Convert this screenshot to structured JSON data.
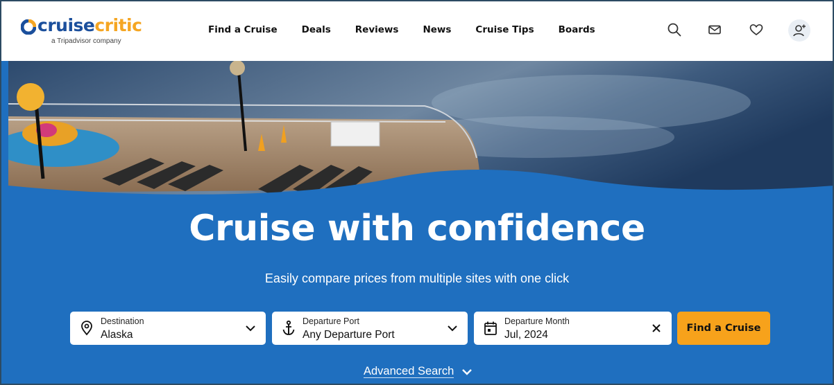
{
  "brand": {
    "name_part1": "cruise",
    "name_part2": "critic",
    "tagline": "a Tripadvisor company"
  },
  "nav": [
    "Find a Cruise",
    "Deals",
    "Reviews",
    "News",
    "Cruise Tips",
    "Boards"
  ],
  "header_icons": [
    "search-icon",
    "mail-icon",
    "heart-icon",
    "user-add-icon"
  ],
  "hero": {
    "headline": "Cruise with confidence",
    "subline": "Easily compare prices from multiple sites with one click"
  },
  "search": {
    "destination": {
      "label": "Destination",
      "value": "Alaska",
      "icon": "location-pin-icon"
    },
    "departure_port": {
      "label": "Departure Port",
      "value": "Any Departure Port",
      "icon": "anchor-icon"
    },
    "departure_month": {
      "label": "Departure Month",
      "value": "Jul, 2024",
      "icon": "calendar-icon"
    },
    "submit_label": "Find a Cruise",
    "advanced_label": "Advanced Search"
  },
  "colors": {
    "brand_blue": "#1f6fbf",
    "brand_orange": "#f7a21b"
  }
}
